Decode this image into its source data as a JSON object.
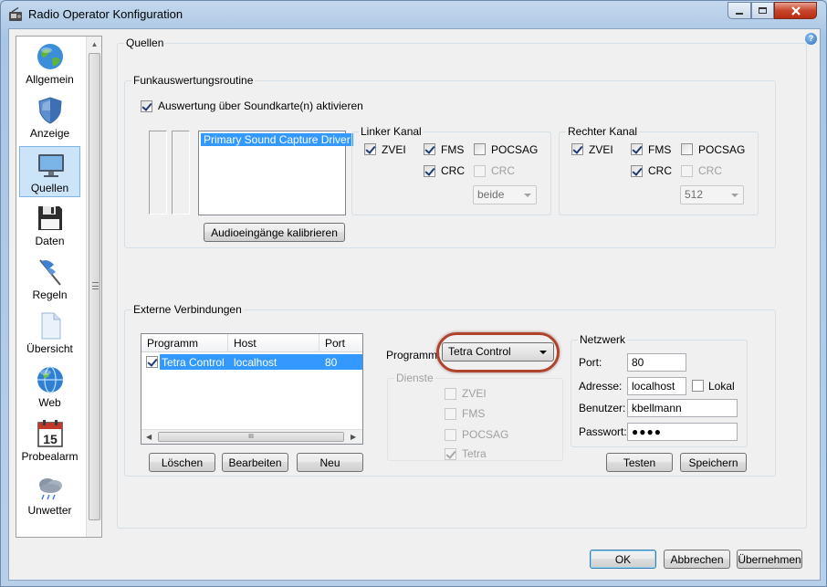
{
  "window": {
    "title": "Radio Operator Konfiguration",
    "help_glyph": "?"
  },
  "sidebar": {
    "items": [
      {
        "label": "Allgemein",
        "icon": "globe-icon"
      },
      {
        "label": "Anzeige",
        "icon": "shield-icon"
      },
      {
        "label": "Quellen",
        "icon": "monitor-icon",
        "selected": true
      },
      {
        "label": "Daten",
        "icon": "floppy-disk-icon"
      },
      {
        "label": "Regeln",
        "icon": "flag-icon"
      },
      {
        "label": "Übersicht",
        "icon": "document-icon"
      },
      {
        "label": "Web",
        "icon": "web-globe-icon"
      },
      {
        "label": "Probealarm",
        "icon": "calendar-icon",
        "calendar_day": "15"
      },
      {
        "label": "Unwetter",
        "icon": "storm-cloud-icon"
      }
    ]
  },
  "quellen": {
    "title": "Quellen",
    "funk": {
      "title": "Funkauswertungsroutine",
      "soundcard_checkbox": {
        "label": "Auswertung über Soundkarte(n) aktivieren",
        "checked": true
      },
      "devices": [
        "Primary Sound Capture Driver"
      ],
      "calibrate_button": "Audioeingänge kalibrieren",
      "linker_kanal": {
        "title": "Linker Kanal",
        "zvei": {
          "label": "ZVEI",
          "checked": true
        },
        "fms": {
          "label": "FMS",
          "checked": true
        },
        "pocsag": {
          "label": "POCSAG",
          "checked": false
        },
        "crc_fms": {
          "label": "CRC",
          "checked": true
        },
        "crc_pocsag": {
          "label": "CRC",
          "checked": false,
          "disabled": true
        },
        "select_value": "beide"
      },
      "rechter_kanal": {
        "title": "Rechter Kanal",
        "zvei": {
          "label": "ZVEI",
          "checked": true
        },
        "fms": {
          "label": "FMS",
          "checked": true
        },
        "pocsag": {
          "label": "POCSAG",
          "checked": false
        },
        "crc_fms": {
          "label": "CRC",
          "checked": true
        },
        "crc_pocsag": {
          "label": "CRC",
          "checked": false,
          "disabled": true
        },
        "select_value": "512"
      }
    },
    "externe": {
      "title": "Externe Verbindungen",
      "table": {
        "columns": [
          "Programm",
          "Host",
          "Port"
        ],
        "rows": [
          {
            "checked": true,
            "programm": "Tetra Control",
            "host": "localhost",
            "port": "80"
          }
        ]
      },
      "hscroll_grip": "III",
      "buttons": {
        "loeschen": "Löschen",
        "bearbeiten": "Bearbeiten",
        "neu": "Neu"
      },
      "programm_label": "Programm:",
      "programm_value": "Tetra Control",
      "dienste": {
        "title": "Dienste",
        "zvei": {
          "label": "ZVEI",
          "checked": false
        },
        "fms": {
          "label": "FMS",
          "checked": false
        },
        "pocsag": {
          "label": "POCSAG",
          "checked": false
        },
        "tetra": {
          "label": "Tetra",
          "checked": true
        }
      },
      "netzwerk": {
        "title": "Netzwerk",
        "port_label": "Port:",
        "port_value": "80",
        "adresse_label": "Adresse:",
        "adresse_value": "localhost",
        "lokal": {
          "label": "Lokal",
          "checked": false
        },
        "benutzer_label": "Benutzer:",
        "benutzer_value": "kbellmann",
        "passwort_label": "Passwort:",
        "passwort_value": "●●●●"
      },
      "testen_button": "Testen",
      "speichern_button": "Speichern"
    }
  },
  "footer": {
    "ok": "OK",
    "abbrechen": "Abbrechen",
    "uebernehmen": "Übernehmen"
  },
  "colors": {
    "selection": "#3399ff",
    "highlight_ring": "#b0432e",
    "sidebar_selected": "#cce4f7"
  }
}
